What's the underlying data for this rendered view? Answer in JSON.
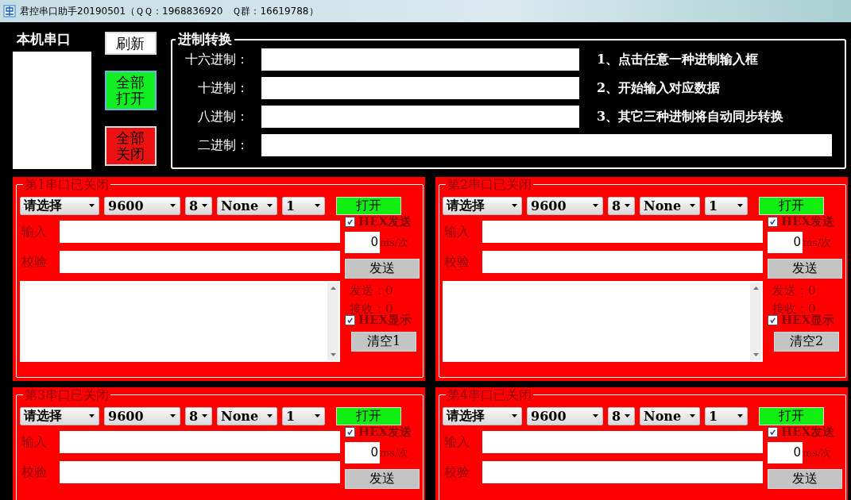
{
  "window": {
    "title": "君控串口助手20190501（ＱＱ：1968836920　Ｑ群：16619788）"
  },
  "local_ports": {
    "label": "本机串口"
  },
  "buttons": [
    {
      "label": "刷新",
      "kind": "plain"
    },
    {
      "label": "全部打开",
      "kind": "green"
    },
    {
      "label": "全部关闭",
      "kind": "red"
    }
  ],
  "converter": {
    "title": "进制转换",
    "rows": [
      {
        "label": "十六进制：",
        "hint": "1、点击任意一种进制输入框"
      },
      {
        "label": "十进制：",
        "hint": "2、开始输入对应数据"
      },
      {
        "label": "八进制：",
        "hint": "3、其它三种进制将自动同步转换"
      },
      {
        "label": "二进制："
      }
    ]
  },
  "ports": [
    {
      "title": "第1串口已关闭",
      "port": "请选择",
      "baud": "9600",
      "data_bits": "8",
      "parity": "None",
      "stop_bits": "1",
      "open_button": "打开",
      "hex_send": {
        "label": "HEX发送",
        "checked": true
      },
      "interval": "0",
      "interval_unit": "ms/次",
      "input_label": "输入",
      "check_label": "校验",
      "send_button": "发送",
      "sent": "发送：0",
      "received": "接收：0",
      "hex_display": {
        "label": "HEX显示",
        "checked": true
      },
      "clear_button": "清空1"
    },
    {
      "title": "第2串口已关闭",
      "port": "请选择",
      "baud": "9600",
      "data_bits": "8",
      "parity": "None",
      "stop_bits": "1",
      "open_button": "打开",
      "hex_send": {
        "label": "HEX发送",
        "checked": true
      },
      "interval": "0",
      "interval_unit": "ms/次",
      "input_label": "输入",
      "check_label": "校验",
      "send_button": "发送",
      "sent": "发送：0",
      "received": "接收：0",
      "hex_display": {
        "label": "HEX显示",
        "checked": true
      },
      "clear_button": "清空2"
    },
    {
      "title": "第3串口已关闭",
      "port": "请选择",
      "baud": "9600",
      "data_bits": "8",
      "parity": "None",
      "stop_bits": "1",
      "open_button": "打开",
      "hex_send": {
        "label": "HEX发送",
        "checked": true
      },
      "interval": "0",
      "interval_unit": "ms/次",
      "input_label": "输入",
      "check_label": "校验",
      "send_button": "发送"
    },
    {
      "title": "第4串口已关闭",
      "port": "请选择",
      "baud": "9600",
      "data_bits": "8",
      "parity": "None",
      "stop_bits": "1",
      "open_button": "打开",
      "hex_send": {
        "label": "HEX发送",
        "checked": true
      },
      "interval": "0",
      "interval_unit": "ms/次",
      "input_label": "输入",
      "check_label": "校验",
      "send_button": "发送"
    }
  ]
}
